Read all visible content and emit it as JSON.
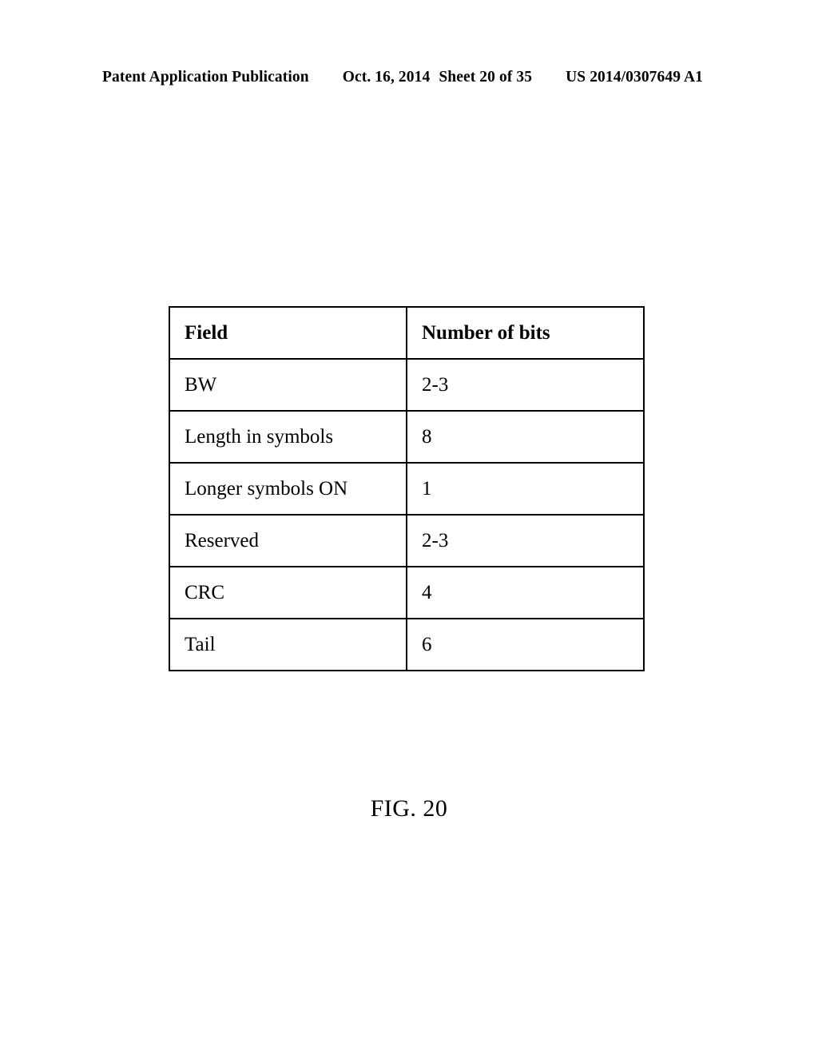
{
  "header": {
    "publication_label": "Patent Application Publication",
    "date": "Oct. 16, 2014",
    "sheet": "Sheet 20 of 35",
    "patent_number": "US 2014/0307649 A1"
  },
  "figure": {
    "caption": "FIG. 20",
    "table": {
      "columns": [
        "Field",
        "Number of bits"
      ],
      "rows": [
        {
          "field": "BW",
          "bits": "2-3"
        },
        {
          "field": "Length in symbols",
          "bits": "8"
        },
        {
          "field": "Longer symbols ON",
          "bits": "1"
        },
        {
          "field": "Reserved",
          "bits": "2-3"
        },
        {
          "field": "CRC",
          "bits": "4"
        },
        {
          "field": "Tail",
          "bits": "6"
        }
      ]
    }
  },
  "colors": {
    "page_background": "#ffffff",
    "text": "#000000",
    "table_border": "#000000"
  }
}
